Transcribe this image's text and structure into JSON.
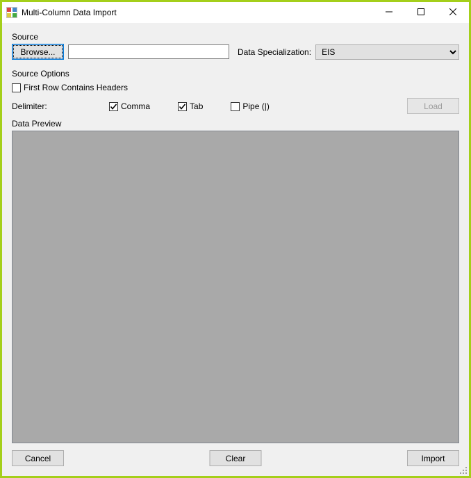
{
  "window": {
    "title": "Multi-Column Data Import"
  },
  "source": {
    "group_label": "Source",
    "browse_label": "Browse...",
    "path_value": "",
    "spec_label": "Data Specialization:",
    "spec_value": "EIS"
  },
  "options": {
    "group_label": "Source Options",
    "first_row_headers_label": "First Row Contains Headers",
    "first_row_headers_checked": false,
    "delimiter_label": "Delimiter:",
    "comma_label": "Comma",
    "comma_checked": true,
    "tab_label": "Tab",
    "tab_checked": true,
    "pipe_label": "Pipe (|)",
    "pipe_checked": false,
    "load_label": "Load"
  },
  "preview": {
    "group_label": "Data Preview"
  },
  "footer": {
    "cancel_label": "Cancel",
    "clear_label": "Clear",
    "import_label": "Import"
  }
}
